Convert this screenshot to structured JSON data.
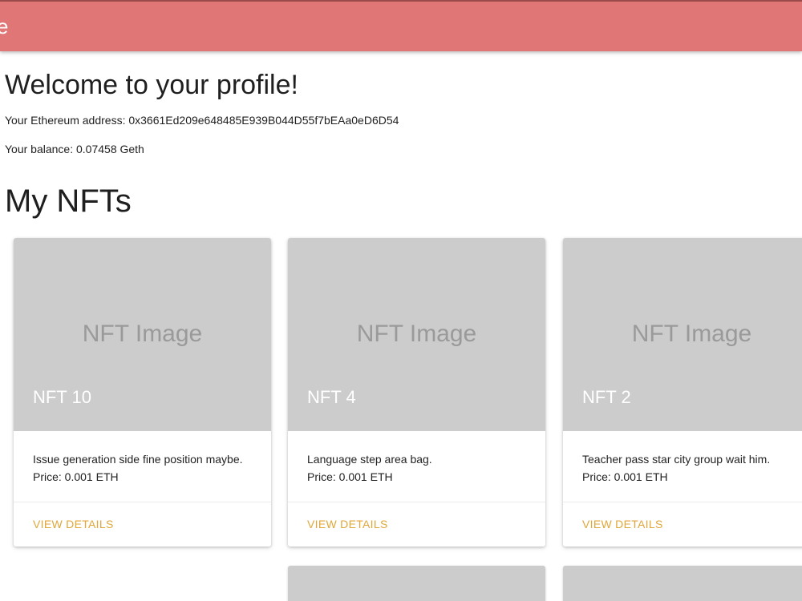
{
  "header": {
    "brand": "e",
    "color": "#e07676"
  },
  "profile": {
    "welcome": "Welcome to your profile!",
    "address": "Your Ethereum address: 0x3661Ed209e648485E939B044D55f7bEAa0eD6D54",
    "balance": "Your balance: 0.07458 Geth"
  },
  "nfts": {
    "heading": "My NFTs",
    "image_placeholder": "NFT Image",
    "action_label": "VIEW DETAILS",
    "items": [
      {
        "title": "NFT 10",
        "description": "Issue generation side fine position maybe.",
        "price": "Price: 0.001 ETH"
      },
      {
        "title": "NFT 4",
        "description": "Language step area bag.",
        "price": "Price: 0.001 ETH"
      },
      {
        "title": "NFT 2",
        "description": "Teacher pass star city group wait him.",
        "price": "Price: 0.001 ETH"
      }
    ]
  },
  "colors": {
    "accent": "#e0a73a",
    "image_bg": "#cccccc"
  }
}
